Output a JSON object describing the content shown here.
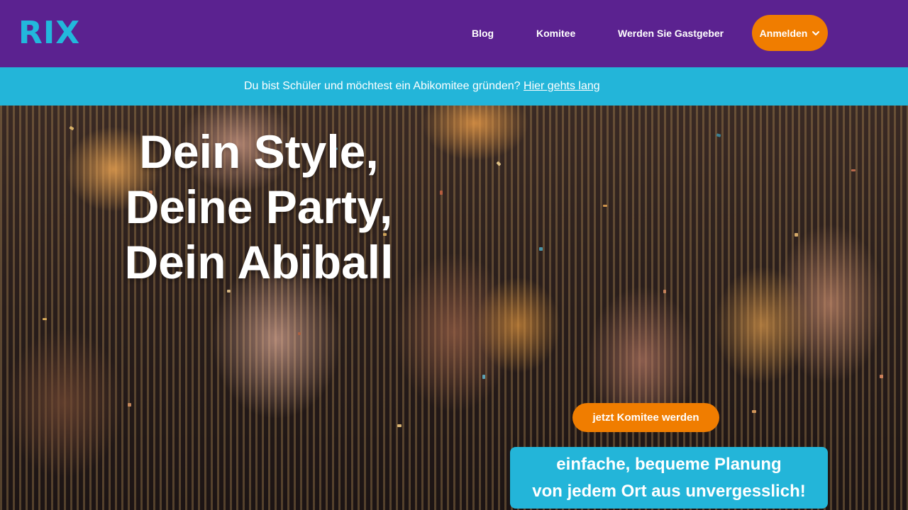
{
  "header": {
    "logo_text": "RIX",
    "nav": [
      {
        "label": "Blog"
      },
      {
        "label": "Komitee"
      },
      {
        "label": "Werden Sie Gastgeber"
      }
    ],
    "login_label": "Anmelden",
    "login_icon": "chevron-down-icon"
  },
  "banner": {
    "text": "Du bist Schüler und möchtest ein Abikomitee gründen?",
    "link_text": "Hier gehts lang"
  },
  "hero": {
    "title_lines": [
      "Dein Style,",
      "Deine Party,",
      "Dein Abiball"
    ],
    "cta_label": "jetzt Komitee werden",
    "tagline_lines": [
      "einfache, bequeme Planung",
      "von jedem Ort aus unvergesslich!"
    ]
  },
  "colors": {
    "nav_bg": "#5b2290",
    "accent_cyan": "#23b5d9",
    "accent_orange": "#f07d00"
  }
}
